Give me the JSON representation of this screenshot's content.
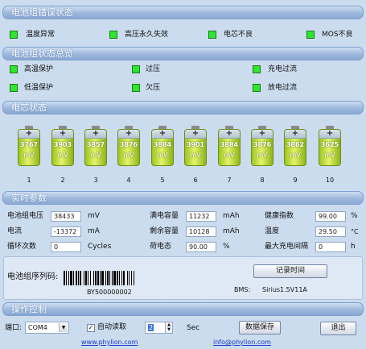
{
  "sections": {
    "battery_error": "电池组错误状态",
    "pack_status": "电池组状态总览",
    "cell_status": "电芯状态",
    "realtime": "实时参数",
    "operation": "操作控制"
  },
  "errors": [
    {
      "label": "温度异常",
      "color": "#2ee62e"
    },
    {
      "label": "高压永久失效",
      "color": "#2ee62e"
    },
    {
      "label": "电芯不良",
      "color": "#2ee62e"
    },
    {
      "label": "MOS不良",
      "color": "#2ee62e"
    }
  ],
  "status": [
    {
      "label": "高温保护"
    },
    {
      "label": "过压"
    },
    {
      "label": "充电过流"
    },
    {
      "label": "低温保护"
    },
    {
      "label": "欠压"
    },
    {
      "label": "放电过流"
    }
  ],
  "cells": {
    "unit": "mV",
    "plus": "+",
    "items": [
      {
        "value": "3767",
        "index": "1"
      },
      {
        "value": "3903",
        "index": "2"
      },
      {
        "value": "3857",
        "index": "3"
      },
      {
        "value": "3876",
        "index": "4"
      },
      {
        "value": "3884",
        "index": "5"
      },
      {
        "value": "3901",
        "index": "6"
      },
      {
        "value": "3884",
        "index": "7"
      },
      {
        "value": "3876",
        "index": "8"
      },
      {
        "value": "3862",
        "index": "9"
      },
      {
        "value": "3625",
        "index": "10"
      }
    ]
  },
  "realtime": {
    "pack_voltage": {
      "label": "电池组电压",
      "value": "38433",
      "unit": "mV"
    },
    "current": {
      "label": "电流",
      "value": "-13372",
      "unit": "mA"
    },
    "cycles": {
      "label": "循环次数",
      "value": "0",
      "unit": "Cycles"
    },
    "full_capacity": {
      "label": "满电容量",
      "value": "11232",
      "unit": "mAh"
    },
    "remain_capacity": {
      "label": "剩余容量",
      "value": "10128",
      "unit": "mAh"
    },
    "soc": {
      "label": "荷电态",
      "value": "90.00",
      "unit": "%"
    },
    "health": {
      "label": "健康指数",
      "value": "99.00",
      "unit": "%"
    },
    "temperature": {
      "label": "温度",
      "value": "29.50",
      "unit": "°C"
    },
    "max_charge_interval": {
      "label": "最大充电间隔",
      "value": "0",
      "unit": "h"
    }
  },
  "serial": {
    "label": "电池组序列码:",
    "code": "BY500000002",
    "record_button": "记录时间",
    "bms_label": "BMS:",
    "bms_value": "Sirius1.5V11A"
  },
  "controls": {
    "port_label": "端口:",
    "port_value": "COM4",
    "auto_read_label": "自动读取",
    "auto_read_checked": "✓",
    "interval_value": "2",
    "interval_unit": "Sec",
    "save_button": "数据保存",
    "exit_button": "退出",
    "website": "www.phylion.com",
    "email": "info@phylion.com"
  }
}
